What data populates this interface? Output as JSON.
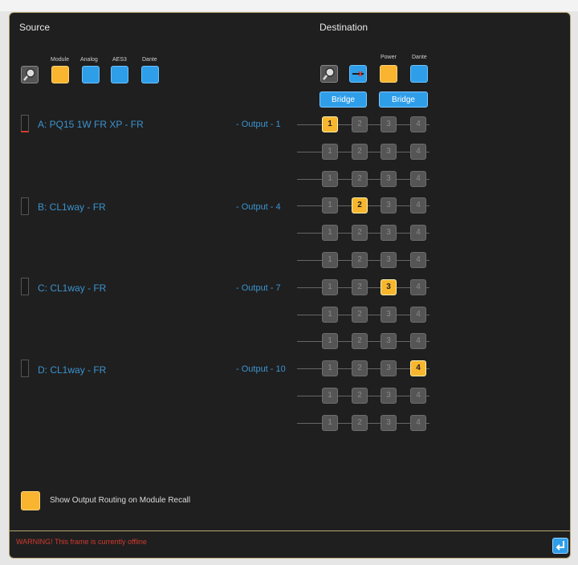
{
  "header": {
    "source_title": "Source",
    "destination_title": "Destination"
  },
  "source_filters": [
    {
      "label": "",
      "icon": "magnifier-icon",
      "color": "gray"
    },
    {
      "label": "Module",
      "color": "#f9b52f"
    },
    {
      "label": "Analog",
      "color": "#2f9ee9"
    },
    {
      "label": "AES3",
      "color": "#2f9ee9"
    },
    {
      "label": "Dante",
      "color": "#2f9ee9"
    }
  ],
  "dest_filters": [
    {
      "label": "",
      "icon": "magnifier-icon",
      "color": "gray"
    },
    {
      "label": "",
      "icon": "cross-link-icon",
      "color": "#2f9ee9"
    },
    {
      "label": "Power",
      "color": "#f9b52f"
    },
    {
      "label": "Dante",
      "color": "#2f9ee9"
    }
  ],
  "bridge_buttons": [
    "Bridge",
    "Bridge"
  ],
  "sources": [
    {
      "name": "A: PQ15 1W FR XP - FR",
      "output": "- Output - 1"
    },
    {
      "name": "B: CL1way - FR",
      "output": "- Output - 4"
    },
    {
      "name": "C: CL1way - FR",
      "output": "- Output - 7"
    },
    {
      "name": "D: CL1way - FR",
      "output": "- Output - 10"
    }
  ],
  "routing": {
    "cell_labels": [
      "1",
      "2",
      "3",
      "4"
    ],
    "rows": 12,
    "active": [
      {
        "row": 0,
        "col": 0
      },
      {
        "row": 3,
        "col": 1
      },
      {
        "row": 6,
        "col": 2
      },
      {
        "row": 9,
        "col": 3
      }
    ]
  },
  "footer": {
    "checkbox_label": "Show Output Routing on Module Recall",
    "warning": "WARNING! This frame is currently offline"
  },
  "colors": {
    "accent_orange": "#f9b52f",
    "accent_blue": "#2f9ee9",
    "warning_red": "#d23b2e"
  }
}
